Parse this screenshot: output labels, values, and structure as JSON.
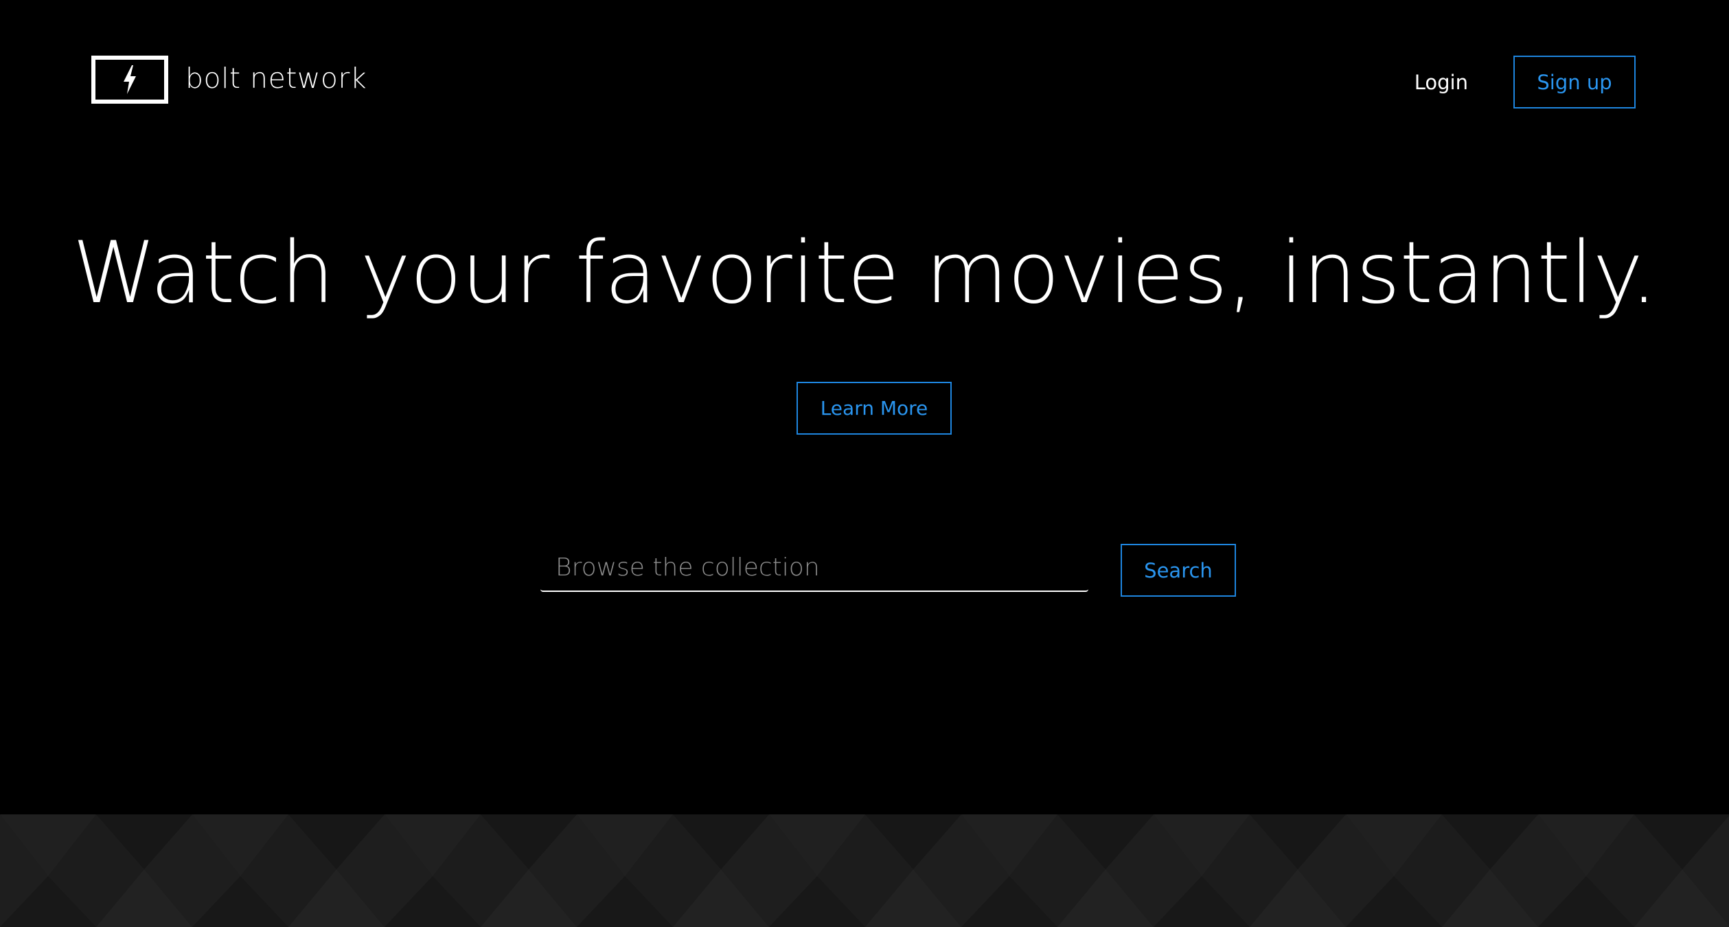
{
  "brand": {
    "name": "bolt network",
    "logo_icon": "bolt-icon"
  },
  "nav": {
    "login_label": "Login",
    "signup_label": "Sign up"
  },
  "hero": {
    "title": "Watch your favorite movies, instantly.",
    "learn_more_label": "Learn More"
  },
  "search": {
    "placeholder": "Browse the collection",
    "value": "",
    "button_label": "Search"
  },
  "colors": {
    "background": "#000000",
    "accent": "#1e86e0",
    "text": "#ffffff",
    "placeholder": "#8e8e8e",
    "pattern_band": "#1c1c1c"
  }
}
